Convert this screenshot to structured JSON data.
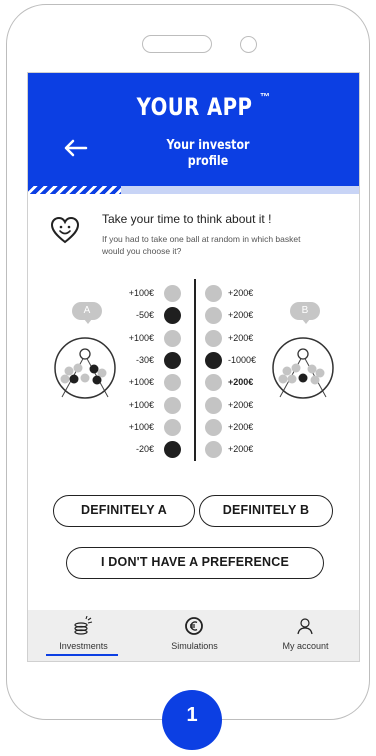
{
  "header": {
    "app_title": "YOUR APP",
    "trademark": "™",
    "subtitle_line1": "Your investor",
    "subtitle_line2": "profile"
  },
  "progress": {
    "fraction": 0.28
  },
  "intro": {
    "prompt": "Take your time to think about it !",
    "question": "If you had to take one ball at random in which basket would you choose it?"
  },
  "baskets": {
    "a_label": "A",
    "b_label": "B"
  },
  "basket_a": [
    {
      "label": "+100€",
      "color": "gray"
    },
    {
      "label": "-50€",
      "color": "black"
    },
    {
      "label": "+100€",
      "color": "gray"
    },
    {
      "label": "-30€",
      "color": "black"
    },
    {
      "label": "+100€",
      "color": "gray"
    },
    {
      "label": "+100€",
      "color": "gray"
    },
    {
      "label": "+100€",
      "color": "gray"
    },
    {
      "label": "-20€",
      "color": "black"
    }
  ],
  "basket_b": [
    {
      "label": "+200€",
      "color": "gray"
    },
    {
      "label": "+200€",
      "color": "gray"
    },
    {
      "label": "+200€",
      "color": "gray"
    },
    {
      "label": "-1000€",
      "color": "black"
    },
    {
      "label": "+200€",
      "color": "gray"
    },
    {
      "label": "+200€",
      "color": "gray"
    },
    {
      "label": "+200€",
      "color": "gray"
    },
    {
      "label": "+200€",
      "color": "gray"
    }
  ],
  "buttons": {
    "choose_a": "DEFINITELY A",
    "choose_b": "DEFINITELY B",
    "no_preference": "I DON'T HAVE A PREFERENCE"
  },
  "tabs": [
    {
      "label": "Investments",
      "icon": "coins-icon",
      "active": true
    },
    {
      "label": "Simulations",
      "icon": "euro-coin-icon",
      "active": false
    },
    {
      "label": "My account",
      "icon": "user-icon",
      "active": false
    }
  ],
  "step": {
    "number": "1"
  },
  "colors": {
    "accent": "#0c3fe3",
    "ball_gray": "#c4c4c4",
    "ball_black": "#1f1f1f",
    "progress_track": "#c8d4f6"
  }
}
